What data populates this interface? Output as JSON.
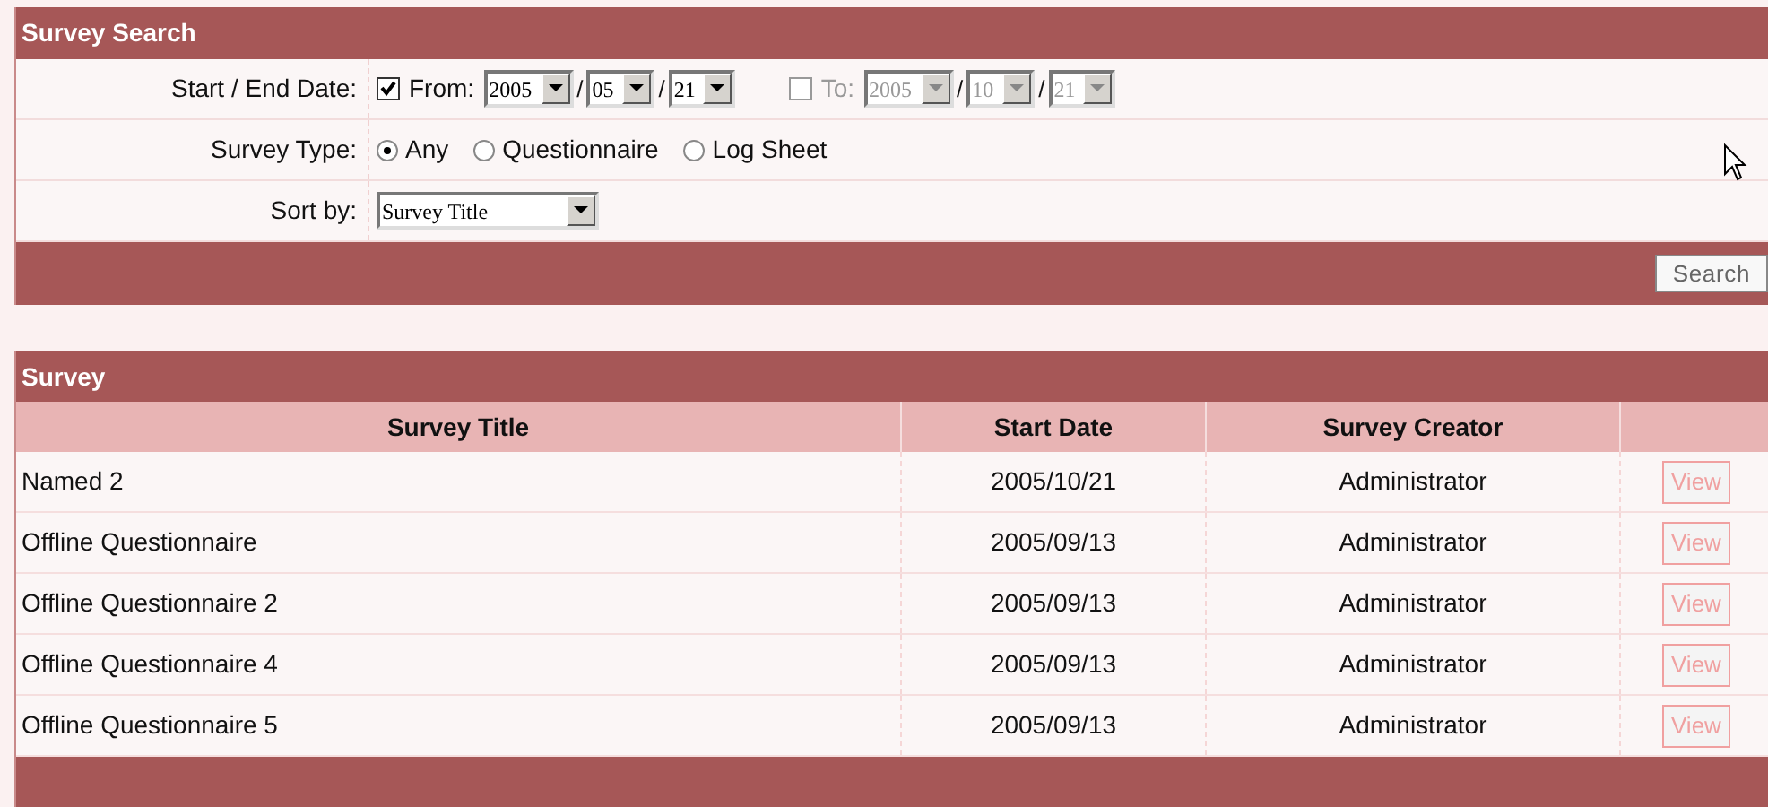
{
  "search_panel": {
    "title": "Survey Search",
    "date_row": {
      "label": "Start / End Date:",
      "parts": [
        {
          "label": "From:",
          "checked": true,
          "disabled": false,
          "year": "2005",
          "month": "05",
          "day": "21"
        },
        {
          "label": "To:",
          "checked": false,
          "disabled": true,
          "year": "2005",
          "month": "10",
          "day": "21"
        }
      ],
      "separator": "/"
    },
    "type_row": {
      "label": "Survey Type:",
      "options": [
        {
          "label": "Any",
          "selected": true
        },
        {
          "label": "Questionnaire",
          "selected": false
        },
        {
          "label": "Log Sheet",
          "selected": false
        }
      ]
    },
    "sort_row": {
      "label": "Sort by:",
      "value": "Survey Title"
    },
    "search_button": "Search"
  },
  "survey_table": {
    "title": "Survey",
    "columns": [
      "Survey Title",
      "Start Date",
      "Survey Creator"
    ],
    "rows": [
      {
        "title": "Named 2",
        "start_date": "2005/10/21",
        "creator": "Administrator",
        "action": "View"
      },
      {
        "title": "Offline Questionnaire",
        "start_date": "2005/09/13",
        "creator": "Administrator",
        "action": "View"
      },
      {
        "title": "Offline Questionnaire 2",
        "start_date": "2005/09/13",
        "creator": "Administrator",
        "action": "View"
      },
      {
        "title": "Offline Questionnaire 4",
        "start_date": "2005/09/13",
        "creator": "Administrator",
        "action": "View"
      },
      {
        "title": "Offline Questionnaire 5",
        "start_date": "2005/09/13",
        "creator": "Administrator",
        "action": "View"
      }
    ]
  }
}
